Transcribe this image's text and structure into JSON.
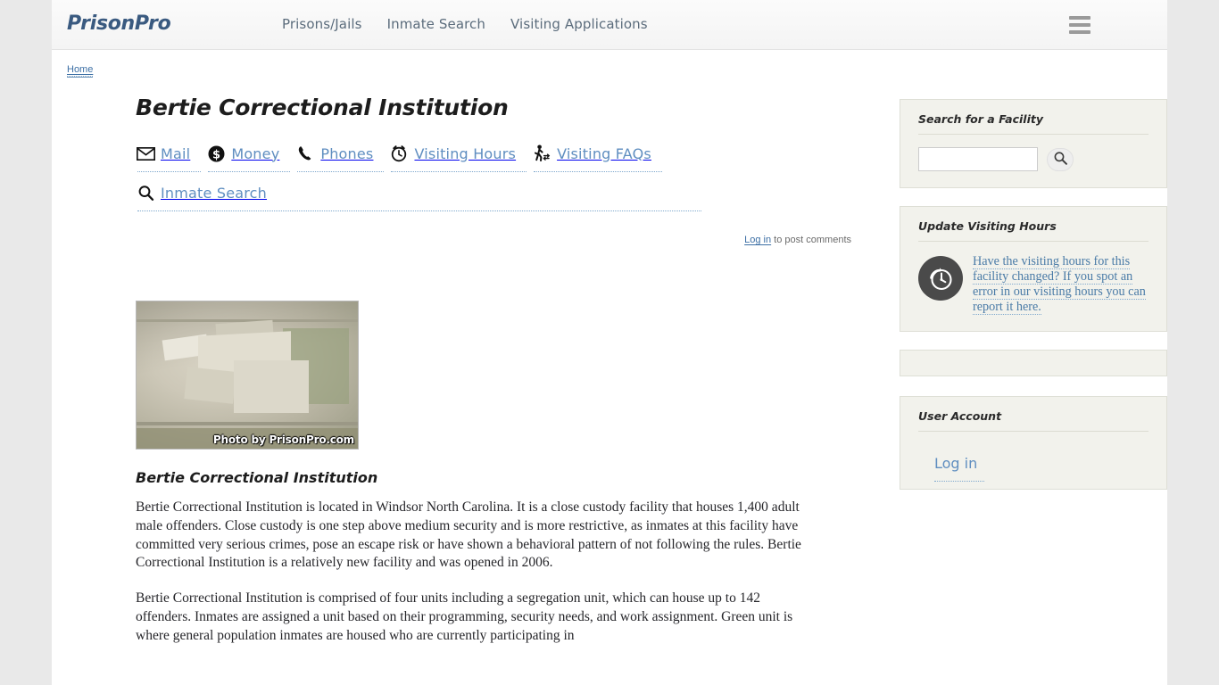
{
  "header": {
    "brand": "PrisonPro",
    "nav": [
      {
        "label": "Prisons/Jails",
        "name": "nav-prisons-jails"
      },
      {
        "label": "Inmate Search",
        "name": "nav-inmate-search"
      },
      {
        "label": "Visiting Applications",
        "name": "nav-visiting-applications"
      }
    ],
    "menu_icon": "hamburger-menu-icon"
  },
  "breadcrumb": {
    "home": "Home"
  },
  "main": {
    "page_title": "Bertie Correctional Institution",
    "icon_links": [
      {
        "label": "Mail",
        "icon": "mail-icon"
      },
      {
        "label": "Money",
        "icon": "money-icon"
      },
      {
        "label": "Phones",
        "icon": "phone-icon"
      },
      {
        "label": "Visiting Hours",
        "icon": "alarm-clock-icon"
      },
      {
        "label": "Visiting FAQs",
        "icon": "walking-person-icon"
      },
      {
        "label": "Inmate Search",
        "icon": "search-icon"
      }
    ],
    "comment_login_link": "Log in",
    "comment_login_rest": " to post comments",
    "photo_credit": "Photo by PrisonPro.com",
    "section_title": "Bertie Correctional Institution",
    "paragraphs": [
      "Bertie Correctional Institution is located in Windsor North Carolina.  It is a close custody facility that houses 1,400 adult male offenders.  Close custody is one step above medium security and is more restrictive, as inmates at this facility have committed very serious crimes, pose an escape risk or have shown a behavioral pattern of not following the rules.  Bertie Correctional Institution is a relatively new facility and was opened in 2006.",
      "Bertie Correctional Institution is comprised of four units including a segregation unit, which can house up to 142 offenders.  Inmates are assigned a unit based on their programming, security needs, and work assignment.  Green unit is where general population inmates are housed who are currently participating in"
    ]
  },
  "sidebar": {
    "search_block": {
      "title": "Search for a Facility",
      "input_value": "",
      "input_placeholder": "",
      "button_icon": "search-icon"
    },
    "update_block": {
      "title": "Update Visiting Hours",
      "icon": "clock-badge-icon",
      "link_text": "Have the visiting hours for this facility changed?  If you spot an error in our visiting hours you can report it here."
    },
    "user_block": {
      "title": "User Account",
      "login_label": "Log in"
    }
  },
  "colors": {
    "page_bg": "#e9e9e9",
    "content_bg": "#ffffff",
    "brand": "#3a5a80",
    "nav_link": "#5b6c7c",
    "icon_link": "#5f8ec0",
    "sidebar_block_bg": "#f2f2ec",
    "sidebar_border": "#dedfd6",
    "serif_link": "#4a7ba7"
  }
}
